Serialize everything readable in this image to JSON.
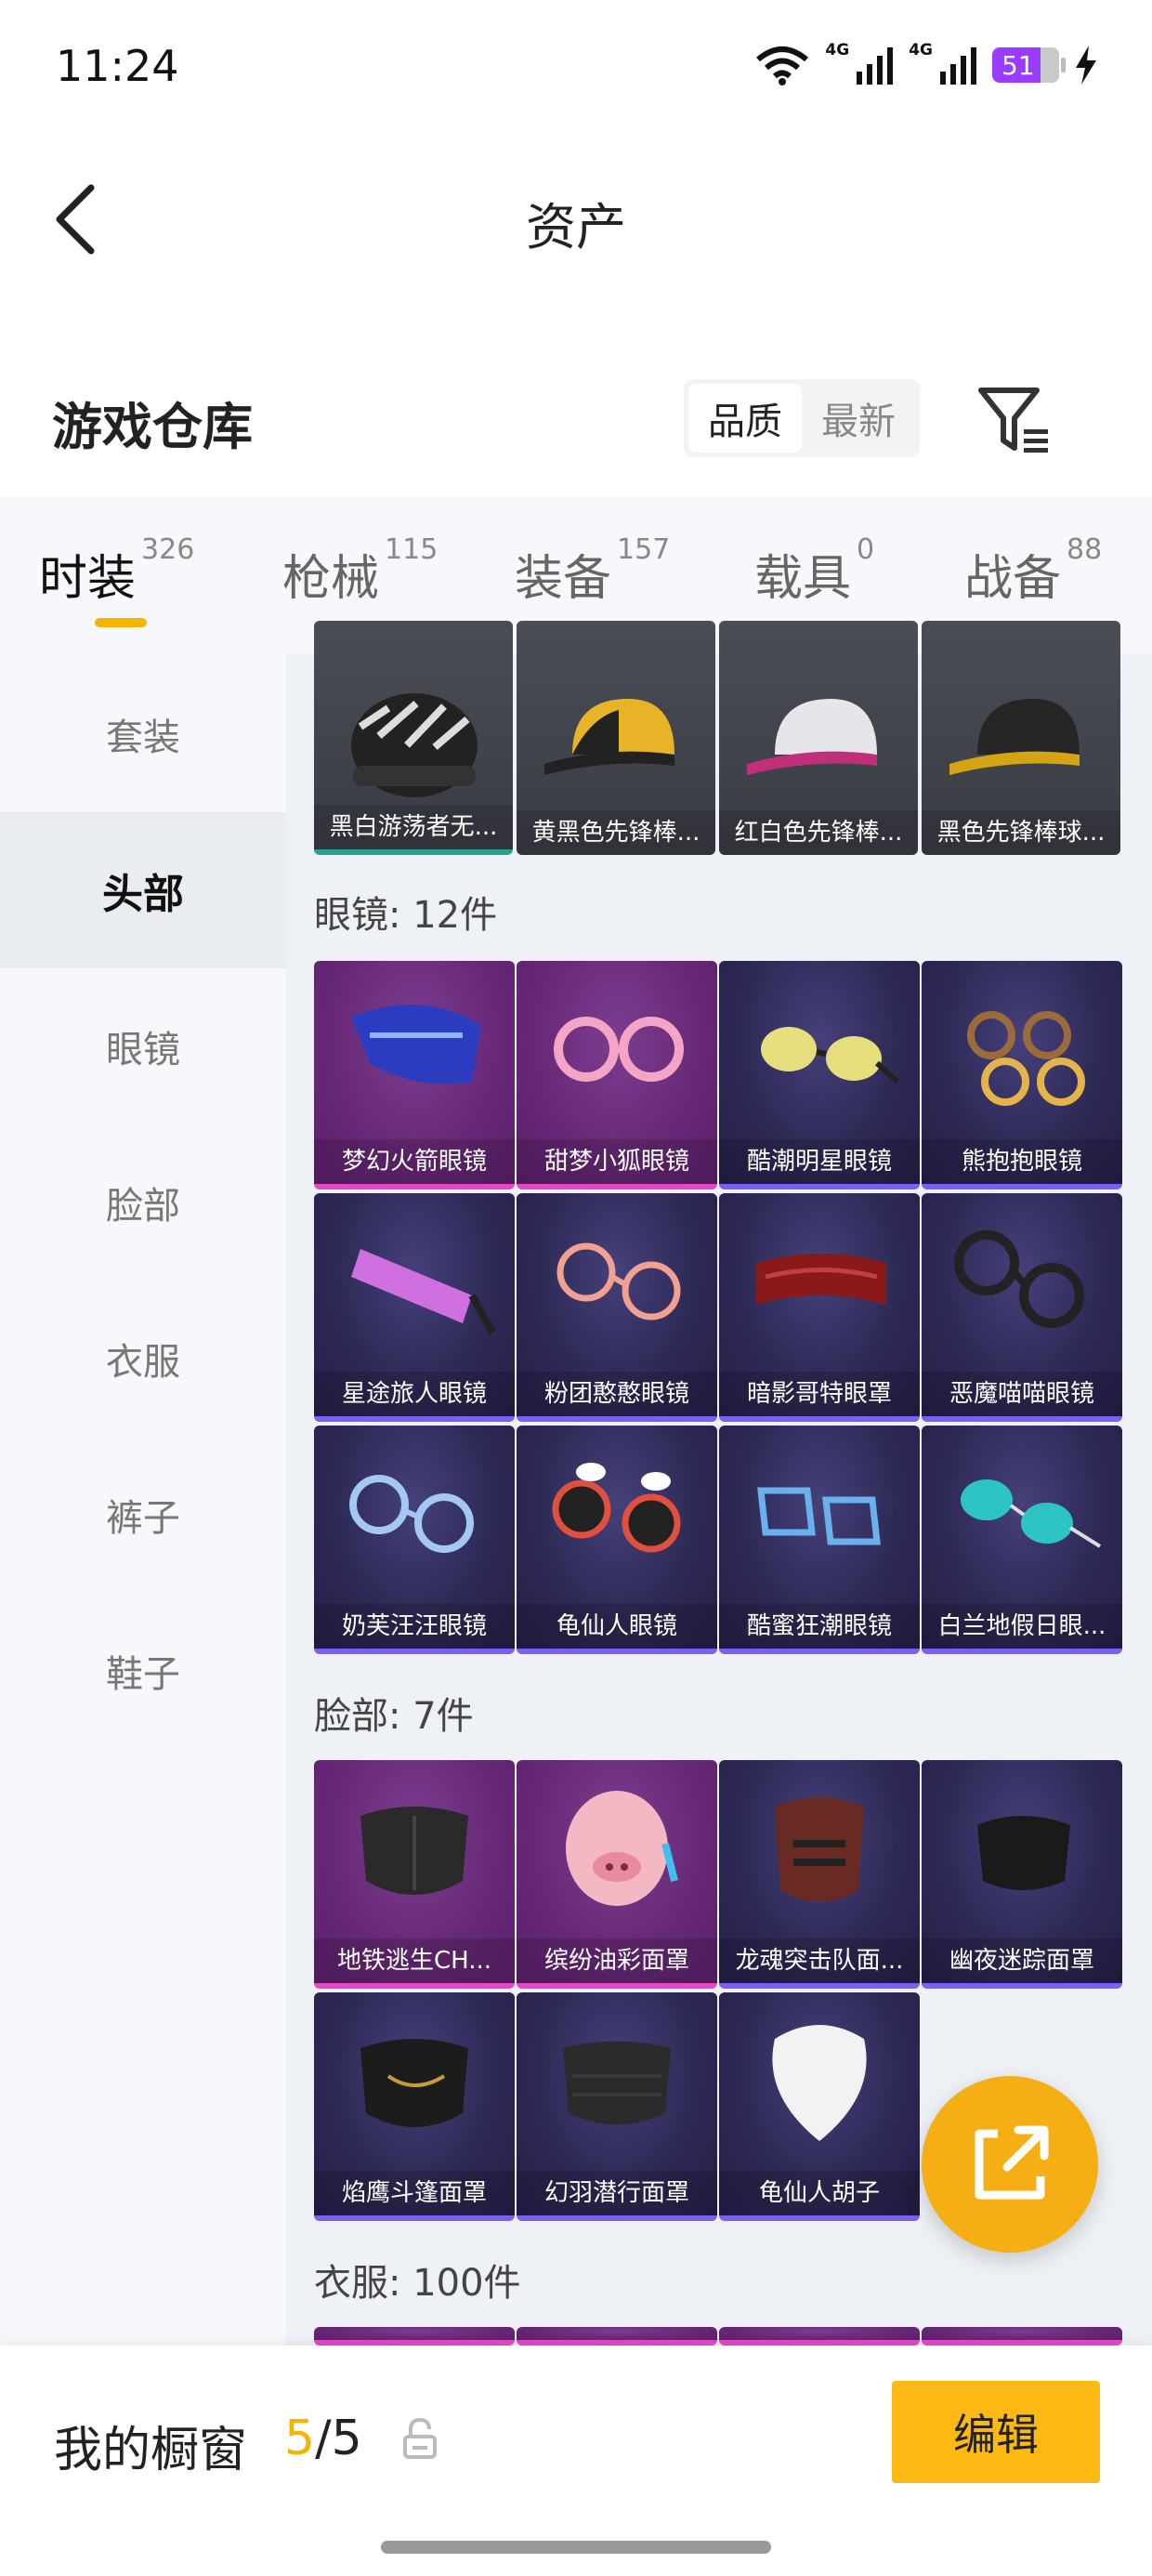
{
  "status": {
    "time": "11:24",
    "net1": "4G",
    "net2": "4G",
    "battery": "51"
  },
  "header": {
    "title": "资产"
  },
  "warehouse": {
    "title": "游戏仓库",
    "sort": [
      "品质",
      "最新"
    ],
    "tabs": [
      {
        "label": "时装",
        "count": "326"
      },
      {
        "label": "枪械",
        "count": "115"
      },
      {
        "label": "装备",
        "count": "157"
      },
      {
        "label": "载具",
        "count": "0"
      },
      {
        "label": "战备",
        "count": "88"
      }
    ],
    "sidebar": [
      "套装",
      "头部",
      "眼镜",
      "脸部",
      "衣服",
      "裤子",
      "鞋子"
    ]
  },
  "hats": [
    "黑白游荡者无...",
    "黄黑色先锋棒...",
    "红白色先锋棒...",
    "黑色先锋棒球..."
  ],
  "glasses": {
    "label": "眼镜: 12件",
    "items": [
      "梦幻火箭眼镜",
      "甜梦小狐眼镜",
      "酷潮明星眼镜",
      "熊抱抱眼镜",
      "星途旅人眼镜",
      "粉团憨憨眼镜",
      "暗影哥特眼罩",
      "恶魔喵喵眼镜",
      "奶芙汪汪眼镜",
      "龟仙人眼镜",
      "酷蜜狂潮眼镜",
      "白兰地假日眼..."
    ]
  },
  "face": {
    "label": "脸部: 7件",
    "items": [
      "地铁逃生CH...",
      "缤纷油彩面罩",
      "龙魂突击队面...",
      "幽夜迷踪面罩",
      "焰鹰斗篷面罩",
      "幻羽潜行面罩",
      "龟仙人胡子"
    ]
  },
  "clothes": {
    "label": "衣服: 100件"
  },
  "bottom": {
    "showcase": "我的橱窗",
    "current": "5",
    "sep": "/",
    "total": "5",
    "edit": "编辑"
  },
  "icons": [
    "back-icon",
    "filter-icon",
    "share-icon",
    "lock-icon",
    "wifi-icon",
    "signal-icon",
    "charging-icon"
  ]
}
